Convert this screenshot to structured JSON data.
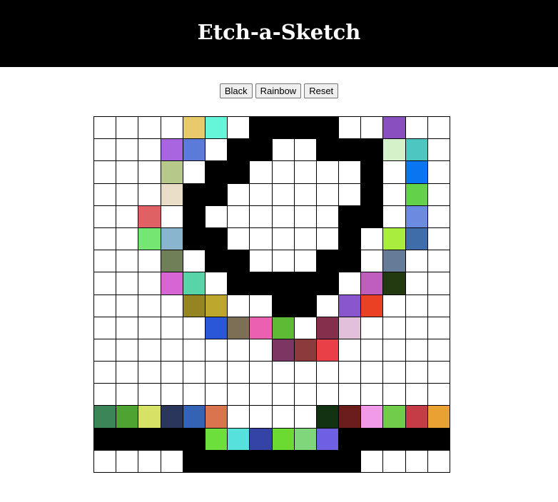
{
  "app": {
    "title": "Etch-a-Sketch"
  },
  "controls": {
    "black_label": "Black",
    "rainbow_label": "Rainbow",
    "reset_label": "Reset"
  },
  "grid": {
    "size": 16,
    "cells": [
      [
        "#ffffff",
        "#ffffff",
        "#ffffff",
        "#ffffff",
        "#e8c96c",
        "#65f6da",
        "#ffffff",
        "#000000",
        "#000000",
        "#000000",
        "#000000",
        "#ffffff",
        "#ffffff",
        "#8a4fbe",
        "#ffffff",
        "#ffffff"
      ],
      [
        "#ffffff",
        "#ffffff",
        "#ffffff",
        "#a865df",
        "#5c7ad9",
        "#ffffff",
        "#000000",
        "#000000",
        "#ffffff",
        "#ffffff",
        "#000000",
        "#000000",
        "#000000",
        "#d5f1c9",
        "#4dc6c2",
        "#ffffff"
      ],
      [
        "#ffffff",
        "#ffffff",
        "#ffffff",
        "#b6c98a",
        "#ffffff",
        "#000000",
        "#000000",
        "#ffffff",
        "#ffffff",
        "#ffffff",
        "#ffffff",
        "#ffffff",
        "#000000",
        "#ffffff",
        "#0975f1",
        "#ffffff"
      ],
      [
        "#ffffff",
        "#ffffff",
        "#ffffff",
        "#eaddc8",
        "#000000",
        "#000000",
        "#ffffff",
        "#ffffff",
        "#ffffff",
        "#ffffff",
        "#ffffff",
        "#ffffff",
        "#000000",
        "#ffffff",
        "#64d14b",
        "#ffffff"
      ],
      [
        "#ffffff",
        "#ffffff",
        "#e06164",
        "#ffffff",
        "#000000",
        "#ffffff",
        "#ffffff",
        "#ffffff",
        "#ffffff",
        "#ffffff",
        "#ffffff",
        "#000000",
        "#000000",
        "#ffffff",
        "#6b8be0",
        "#ffffff"
      ],
      [
        "#ffffff",
        "#ffffff",
        "#76e672",
        "#8ab5cf",
        "#000000",
        "#000000",
        "#ffffff",
        "#ffffff",
        "#ffffff",
        "#ffffff",
        "#ffffff",
        "#000000",
        "#ffffff",
        "#a9ed3f",
        "#3e6daa",
        "#ffffff"
      ],
      [
        "#ffffff",
        "#ffffff",
        "#ffffff",
        "#6f7f58",
        "#ffffff",
        "#000000",
        "#000000",
        "#ffffff",
        "#ffffff",
        "#ffffff",
        "#000000",
        "#000000",
        "#ffffff",
        "#657b97",
        "#ffffff",
        "#ffffff"
      ],
      [
        "#ffffff",
        "#ffffff",
        "#ffffff",
        "#d765d3",
        "#59d3a8",
        "#ffffff",
        "#000000",
        "#000000",
        "#000000",
        "#000000",
        "#000000",
        "#ffffff",
        "#c05ebe",
        "#233a10",
        "#ffffff",
        "#ffffff"
      ],
      [
        "#ffffff",
        "#ffffff",
        "#ffffff",
        "#ffffff",
        "#948522",
        "#bda62c",
        "#ffffff",
        "#ffffff",
        "#000000",
        "#000000",
        "#ffffff",
        "#8955cc",
        "#ea4124",
        "#ffffff",
        "#ffffff",
        "#ffffff"
      ],
      [
        "#ffffff",
        "#ffffff",
        "#ffffff",
        "#ffffff",
        "#ffffff",
        "#2a56d8",
        "#7c6f56",
        "#eb60b1",
        "#5eba34",
        "#ffffff",
        "#84304c",
        "#e2bfdb",
        "#ffffff",
        "#ffffff",
        "#ffffff",
        "#ffffff"
      ],
      [
        "#ffffff",
        "#ffffff",
        "#ffffff",
        "#ffffff",
        "#ffffff",
        "#ffffff",
        "#ffffff",
        "#ffffff",
        "#7b3664",
        "#8c3b3c",
        "#e94047",
        "#ffffff",
        "#ffffff",
        "#ffffff",
        "#ffffff",
        "#ffffff"
      ],
      [
        "#ffffff",
        "#ffffff",
        "#ffffff",
        "#ffffff",
        "#ffffff",
        "#ffffff",
        "#ffffff",
        "#ffffff",
        "#ffffff",
        "#ffffff",
        "#ffffff",
        "#ffffff",
        "#ffffff",
        "#ffffff",
        "#ffffff",
        "#ffffff"
      ],
      [
        "#ffffff",
        "#ffffff",
        "#ffffff",
        "#ffffff",
        "#ffffff",
        "#ffffff",
        "#ffffff",
        "#ffffff",
        "#ffffff",
        "#ffffff",
        "#ffffff",
        "#ffffff",
        "#ffffff",
        "#ffffff",
        "#ffffff",
        "#ffffff"
      ],
      [
        "#3c8559",
        "#4fa330",
        "#d6e265",
        "#2b365c",
        "#3462b5",
        "#da744f",
        "#ffffff",
        "#ffffff",
        "#ffffff",
        "#ffffff",
        "#133211",
        "#6b1d1b",
        "#f09ae9",
        "#72cc4b",
        "#c63c46",
        "#e9a131"
      ],
      [
        "#000000",
        "#000000",
        "#000000",
        "#000000",
        "#000000",
        "#6ddf3d",
        "#56e1dd",
        "#3444a6",
        "#6bda31",
        "#7fd67b",
        "#6f5fe2",
        "#000000",
        "#000000",
        "#000000",
        "#000000",
        "#000000"
      ],
      [
        "#ffffff",
        "#ffffff",
        "#ffffff",
        "#ffffff",
        "#000000",
        "#000000",
        "#000000",
        "#000000",
        "#000000",
        "#000000",
        "#000000",
        "#000000",
        "#ffffff",
        "#ffffff",
        "#ffffff",
        "#ffffff"
      ]
    ]
  }
}
